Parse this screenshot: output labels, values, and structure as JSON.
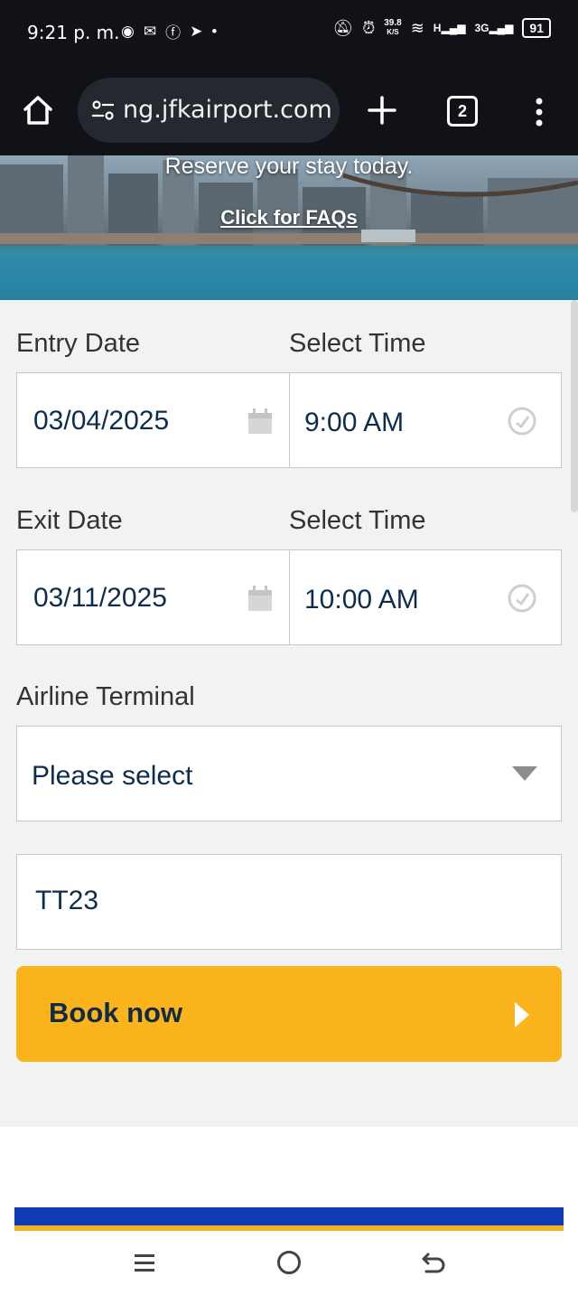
{
  "status_bar": {
    "time": "9:21 p. m.",
    "net_speed_value": "39.8",
    "net_speed_unit": "K/S",
    "signal_1": "H",
    "signal_2": "3G",
    "battery": "91"
  },
  "browser": {
    "url": "ng.jfkairport.com",
    "tab_count": "2"
  },
  "hero": {
    "tagline": "Reserve your stay today.",
    "faq_link": "Click for FAQs"
  },
  "form": {
    "entry_date_label": "Entry Date",
    "entry_time_label": "Select Time",
    "entry_date_value": "03/04/2025",
    "entry_time_value": "9:00 AM",
    "exit_date_label": "Exit Date",
    "exit_time_label": "Select Time",
    "exit_date_value": "03/11/2025",
    "exit_time_value": "10:00 AM",
    "terminal_label": "Airline Terminal",
    "terminal_value": "Please select",
    "promo_value": "TT23",
    "book_label": "Book now"
  },
  "colors": {
    "accent": "#fbb41b",
    "text_dark": "#0c2d4e",
    "stripe_blue": "#0d3bb3"
  }
}
